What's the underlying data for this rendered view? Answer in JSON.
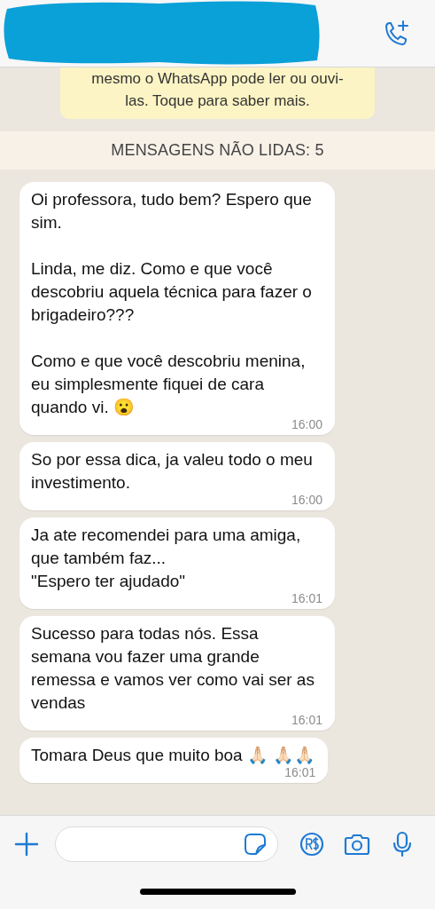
{
  "header": {
    "redacted": true
  },
  "encryption_notice": {
    "text": "mesmo o WhatsApp pode ler ou ouvi-\nlas. Toque para saber mais."
  },
  "unread_divider": {
    "text": "MENSAGENS NÃO LIDAS: 5"
  },
  "messages": [
    {
      "text": "Oi professora, tudo bem? Espero que sim.\n\nLinda, me diz. Como e que você descobriu aquela técnica para fazer o brigadeiro???\n\nComo e que você descobriu menina, eu simplesmente fiquei de cara quando vi. 😮",
      "time": "16:00"
    },
    {
      "text": "So por essa dica, ja valeu todo o meu investimento.",
      "time": "16:00"
    },
    {
      "text": "Ja ate recomendei para uma amiga, que também faz...\n\"Espero ter ajudado\"",
      "time": "16:01"
    },
    {
      "text": "Sucesso para todas nós. Essa semana vou fazer uma grande remessa e vamos ver como vai ser as vendas",
      "time": "16:01"
    },
    {
      "text": "Tomara Deus que muito boa 🙏🏻 🙏🏻🙏🏻",
      "time": "16:01"
    }
  ]
}
